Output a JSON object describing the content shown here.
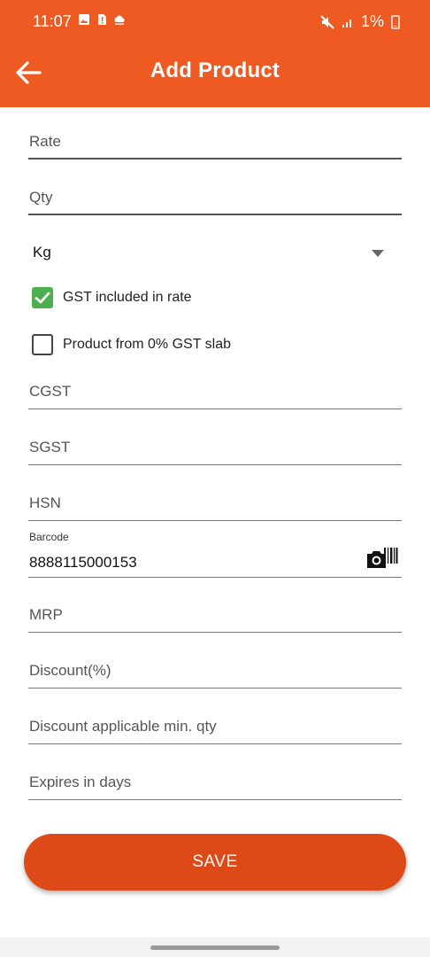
{
  "status_bar": {
    "time": "11:07",
    "battery_text": "1%",
    "left_icons": [
      "image-icon",
      "sim-alert-icon",
      "cloud-icon"
    ],
    "right_icons": [
      "mute-icon",
      "signal-icon",
      "battery-icon"
    ]
  },
  "header": {
    "title": "Add Product",
    "back_icon": "arrow-left-icon",
    "background": "#ee5a22"
  },
  "form": {
    "rate_placeholder": "Rate",
    "qty_placeholder": "Qty",
    "unit_selected": "Kg",
    "gst_included_label": "GST included in rate",
    "gst_included_checked": true,
    "zero_gst_label": "Product from 0% GST slab",
    "zero_gst_checked": false,
    "cgst_placeholder": "CGST",
    "sgst_placeholder": "SGST",
    "hsn_placeholder": "HSN",
    "barcode_label": "Barcode",
    "barcode_value": "8888115000153",
    "mrp_placeholder": "MRP",
    "discount_placeholder": "Discount(%)",
    "discount_min_qty_placeholder": "Discount applicable min. qty",
    "expires_placeholder": "Expires in days"
  },
  "actions": {
    "save_label": "SAVE",
    "save_color": "#dd4a18"
  },
  "colors": {
    "accent": "#ee5a22",
    "checkbox_green": "#4caf50"
  }
}
